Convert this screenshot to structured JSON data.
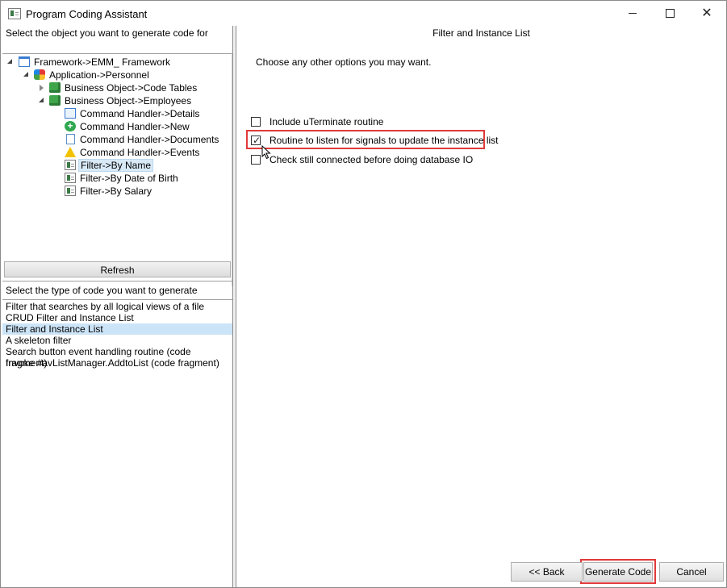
{
  "window": {
    "title": "Program Coding Assistant"
  },
  "left": {
    "object_header": "Select the object you want to generate code for",
    "tree": [
      {
        "label": "Framework->EMM_ Framework",
        "icon": "framework-icon"
      },
      {
        "label": "Application->Personnel",
        "icon": "application-icon"
      },
      {
        "label": "Business Object->Code Tables",
        "icon": "business-object-icon"
      },
      {
        "label": "Business Object->Employees",
        "icon": "business-object-icon"
      },
      {
        "label": "Command Handler->Details",
        "icon": "window-icon"
      },
      {
        "label": "Command Handler->New",
        "icon": "add-icon"
      },
      {
        "label": "Command Handler->Documents",
        "icon": "document-icon"
      },
      {
        "label": "Command Handler->Events",
        "icon": "warning-icon"
      },
      {
        "label": "Filter->By Name",
        "icon": "filter-icon",
        "selected": true
      },
      {
        "label": "Filter->By Date of Birth",
        "icon": "filter-icon"
      },
      {
        "label": "Filter->By Salary",
        "icon": "filter-icon"
      }
    ],
    "refresh_label": "Refresh",
    "type_header": "Select the type of code you want to generate",
    "types": [
      "Filter that searches by all logical views of a file",
      "CRUD Filter and Instance List",
      "Filter and Instance List",
      "A skeleton filter",
      "Search button event handling routine (code fragment)",
      "Invoke #avListManager.AddtoList (code fragment)"
    ],
    "selected_type": "Filter and Instance List"
  },
  "right": {
    "panel_title": "Filter and Instance List",
    "intro": "Choose any other options you may want.",
    "options": [
      {
        "label": "Include uTerminate routine",
        "checked": false
      },
      {
        "label": "Routine to listen for signals to update the instance list",
        "checked": true
      },
      {
        "label": "Check still connected before doing database IO",
        "checked": false
      }
    ],
    "buttons": {
      "back": "<< Back",
      "generate": "Generate Code",
      "cancel": "Cancel"
    }
  },
  "colors": {
    "highlight": "#e03a3a",
    "selection": "#cce4f7"
  }
}
